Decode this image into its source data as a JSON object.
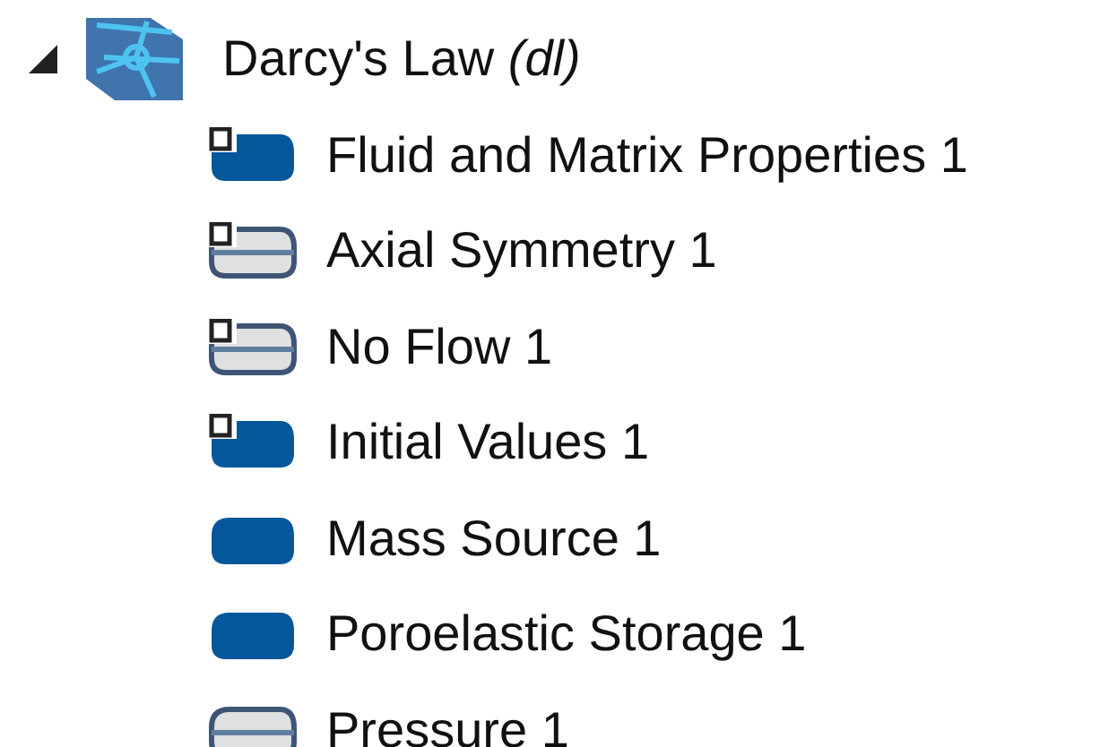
{
  "tree": {
    "label": "Darcy's Law *(dl)*",
    "expanded": true,
    "children": [
      {
        "label": "Fluid and Matrix Properties 1",
        "kind": "domain",
        "default": true
      },
      {
        "label": "Axial Symmetry 1",
        "kind": "boundary",
        "default": true
      },
      {
        "label": "No Flow 1",
        "kind": "boundary",
        "default": true
      },
      {
        "label": "Initial Values 1",
        "kind": "domain",
        "default": true
      },
      {
        "label": "Mass Source 1",
        "kind": "domain",
        "default": false
      },
      {
        "label": "Poroelastic Storage 1",
        "kind": "domain",
        "default": false
      },
      {
        "label": "Pressure 1",
        "kind": "boundary",
        "default": false
      }
    ]
  }
}
